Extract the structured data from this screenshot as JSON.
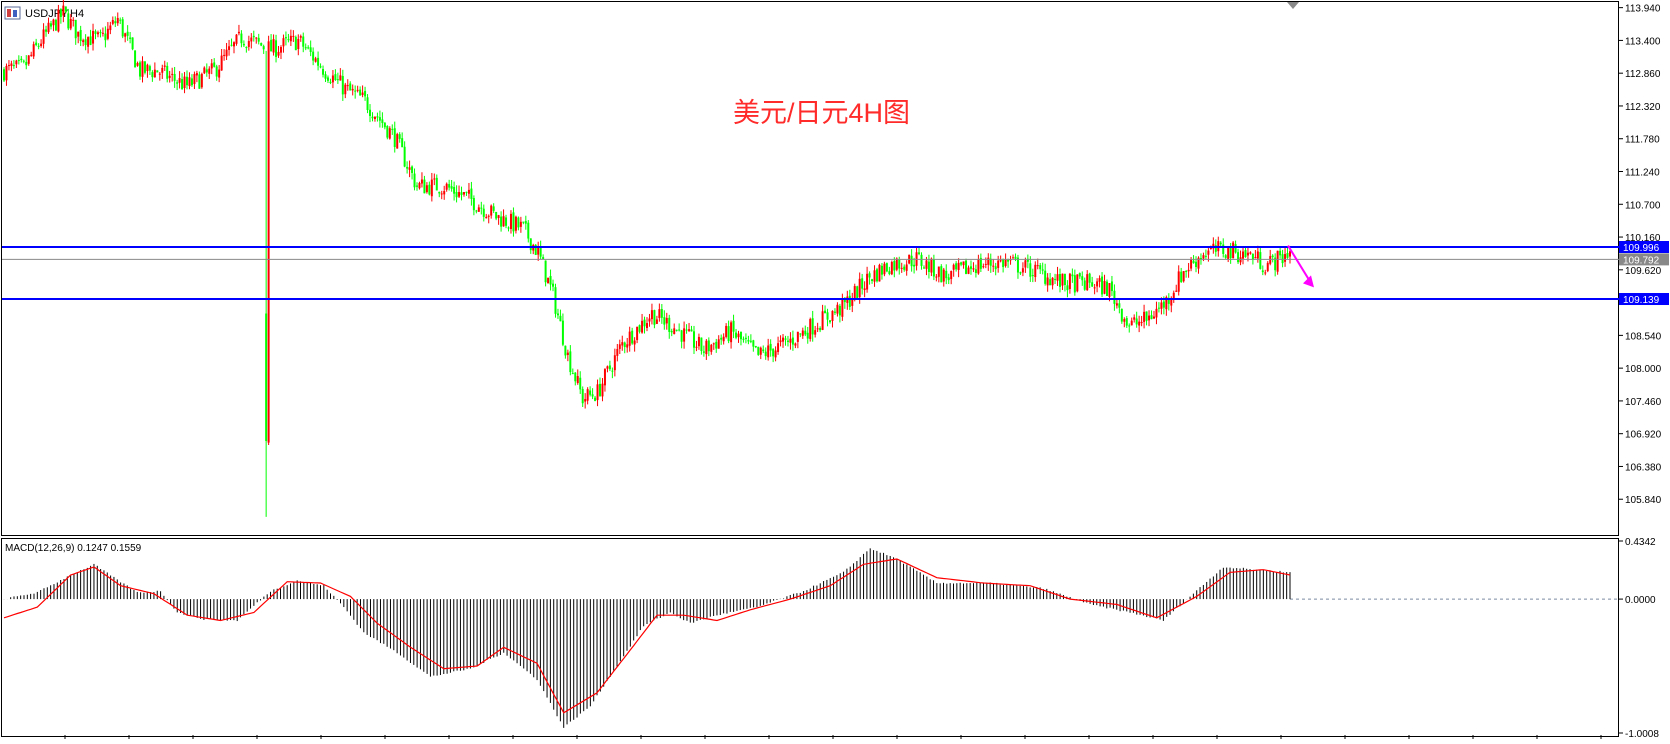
{
  "window": {
    "symbol_label": "USDJPY,H4",
    "icon_name": "chart-window-icon"
  },
  "annotation": {
    "text": "美元/日元4H图",
    "color": "#ff2a2a"
  },
  "colors": {
    "bull": "#ff0000",
    "bear": "#00ff00",
    "level_line": "#0000ff",
    "bid_line": "#888888",
    "forecast_arrow": "#ff00ff",
    "macd_hist": "#000000",
    "macd_signal": "#ff0000",
    "frame": "#000000"
  },
  "chart_data": [
    {
      "type": "candlestick",
      "symbol": "USDJPY",
      "timeframe": "H4",
      "y_axis_ticks": [
        "113.940",
        "113.400",
        "112.860",
        "112.320",
        "111.780",
        "111.240",
        "110.700",
        "110.160",
        "109.620",
        "108.540",
        "108.000",
        "107.460",
        "106.920",
        "106.380",
        "105.840"
      ],
      "ylim": [
        105.3,
        114.0
      ],
      "ohlc_count": 202,
      "control_points": [
        [
          0,
          112.9
        ],
        [
          8,
          112.95
        ],
        [
          15,
          113.4
        ],
        [
          24,
          113.85
        ],
        [
          30,
          113.5
        ],
        [
          39,
          113.4
        ],
        [
          46,
          113.75
        ],
        [
          55,
          112.9
        ],
        [
          62,
          112.9
        ],
        [
          74,
          112.65
        ],
        [
          85,
          112.9
        ],
        [
          96,
          113.45
        ],
        [
          108,
          113.25
        ],
        [
          119,
          113.4
        ],
        [
          130,
          112.9
        ],
        [
          138,
          112.6
        ],
        [
          146,
          112.4
        ],
        [
          158,
          111.8
        ],
        [
          167,
          111.0
        ],
        [
          178,
          111.0
        ],
        [
          188,
          110.8
        ],
        [
          199,
          110.5
        ],
        [
          210,
          110.3
        ],
        [
          216,
          109.9
        ],
        [
          222,
          109.2
        ],
        [
          228,
          108.2
        ],
        [
          234,
          107.5
        ],
        [
          240,
          107.6
        ],
        [
          250,
          108.4
        ],
        [
          262,
          108.9
        ],
        [
          270,
          108.7
        ],
        [
          283,
          108.3
        ],
        [
          294,
          108.6
        ],
        [
          305,
          108.2
        ],
        [
          316,
          108.4
        ],
        [
          327,
          108.7
        ],
        [
          339,
          109.0
        ],
        [
          350,
          109.5
        ],
        [
          358,
          109.7
        ],
        [
          369,
          109.8
        ],
        [
          381,
          109.5
        ],
        [
          393,
          109.7
        ],
        [
          405,
          109.75
        ],
        [
          417,
          109.6
        ],
        [
          428,
          109.4
        ],
        [
          440,
          109.4
        ],
        [
          447,
          109.3
        ],
        [
          455,
          108.7
        ],
        [
          462,
          108.8
        ],
        [
          470,
          109.1
        ],
        [
          477,
          109.6
        ],
        [
          485,
          109.9
        ],
        [
          493,
          109.95
        ],
        [
          505,
          109.85
        ],
        [
          510,
          109.7
        ],
        [
          516,
          109.8
        ],
        [
          520,
          109.95
        ]
      ],
      "highlights": [
        {
          "bar": 106,
          "kind": "spike_low",
          "value": 105.55
        },
        {
          "bar": 106,
          "kind": "open_close",
          "open": 108.9,
          "close": 106.8
        }
      ],
      "levels": [
        {
          "price": 109.996,
          "label": "109.996",
          "kind": "resistance"
        },
        {
          "price": 109.139,
          "label": "109.139",
          "kind": "support"
        }
      ],
      "current_price": {
        "price": 109.792,
        "label": "109.792"
      },
      "forecast_arrow": {
        "from_price": 110.02,
        "to_price": 109.33,
        "direction": "down"
      }
    },
    {
      "type": "macd",
      "title": "MACD(12,26,9) 0.1247 0.1559",
      "params": [
        12,
        26,
        9
      ],
      "last_macd": 0.1247,
      "last_signal": 0.1559,
      "y_axis_ticks": [
        "0.4342",
        "0.0000",
        "-1.0008"
      ],
      "ylim": [
        -1.0008,
        0.4342
      ],
      "zero_line": 0.0,
      "histogram_control_points": [
        [
          0,
          0.0
        ],
        [
          10,
          0.05
        ],
        [
          20,
          0.18
        ],
        [
          27,
          0.26
        ],
        [
          33,
          0.16
        ],
        [
          40,
          0.05
        ],
        [
          47,
          0.06
        ],
        [
          52,
          -0.1
        ],
        [
          60,
          -0.15
        ],
        [
          70,
          -0.16
        ],
        [
          80,
          0.06
        ],
        [
          88,
          0.14
        ],
        [
          96,
          0.1
        ],
        [
          102,
          -0.06
        ],
        [
          108,
          -0.25
        ],
        [
          118,
          -0.4
        ],
        [
          128,
          -0.58
        ],
        [
          140,
          -0.52
        ],
        [
          150,
          -0.4
        ],
        [
          160,
          -0.6
        ],
        [
          168,
          -0.96
        ],
        [
          176,
          -0.8
        ],
        [
          184,
          -0.5
        ],
        [
          192,
          -0.2
        ],
        [
          200,
          -0.1
        ],
        [
          206,
          -0.18
        ],
        [
          214,
          -0.12
        ],
        [
          226,
          -0.06
        ],
        [
          240,
          0.06
        ],
        [
          252,
          0.2
        ],
        [
          260,
          0.38
        ],
        [
          268,
          0.3
        ],
        [
          280,
          0.12
        ],
        [
          296,
          0.12
        ],
        [
          312,
          0.08
        ],
        [
          326,
          -0.04
        ],
        [
          338,
          -0.1
        ],
        [
          348,
          -0.16
        ],
        [
          356,
          0.02
        ],
        [
          366,
          0.24
        ],
        [
          376,
          0.22
        ],
        [
          386,
          0.2
        ]
      ],
      "signal_control_points": [
        [
          0,
          -0.14
        ],
        [
          10,
          -0.06
        ],
        [
          20,
          0.18
        ],
        [
          27,
          0.24
        ],
        [
          35,
          0.1
        ],
        [
          45,
          0.04
        ],
        [
          55,
          -0.12
        ],
        [
          65,
          -0.16
        ],
        [
          75,
          -0.1
        ],
        [
          85,
          0.13
        ],
        [
          95,
          0.12
        ],
        [
          104,
          0.02
        ],
        [
          112,
          -0.18
        ],
        [
          122,
          -0.36
        ],
        [
          132,
          -0.52
        ],
        [
          142,
          -0.5
        ],
        [
          150,
          -0.36
        ],
        [
          160,
          -0.48
        ],
        [
          168,
          -0.85
        ],
        [
          178,
          -0.7
        ],
        [
          188,
          -0.38
        ],
        [
          196,
          -0.12
        ],
        [
          204,
          -0.12
        ],
        [
          214,
          -0.16
        ],
        [
          224,
          -0.08
        ],
        [
          236,
          0.0
        ],
        [
          248,
          0.1
        ],
        [
          258,
          0.26
        ],
        [
          268,
          0.3
        ],
        [
          280,
          0.16
        ],
        [
          294,
          0.12
        ],
        [
          308,
          0.1
        ],
        [
          320,
          0.0
        ],
        [
          334,
          -0.04
        ],
        [
          346,
          -0.14
        ],
        [
          358,
          0.02
        ],
        [
          368,
          0.2
        ],
        [
          378,
          0.22
        ],
        [
          386,
          0.18
        ]
      ]
    }
  ]
}
